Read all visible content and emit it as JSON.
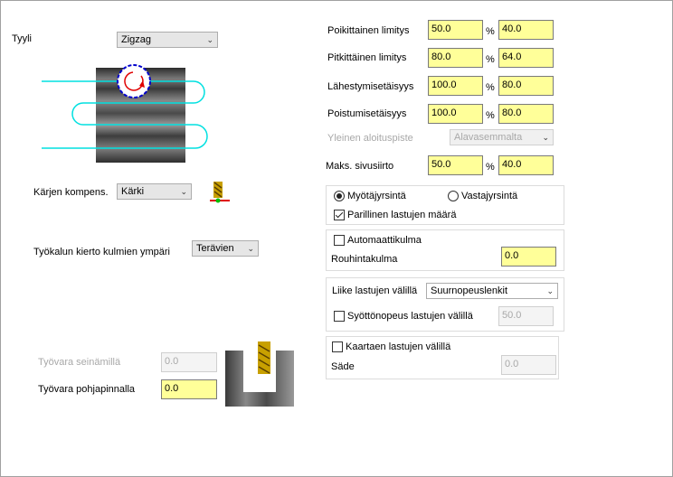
{
  "left": {
    "style_label": "Tyyli",
    "style_value": "Zigzag",
    "edge_comp_label": "Kärjen kompens.",
    "edge_comp_value": "Kärki",
    "corner_label": "Työkalun kierto kulmien ympäri",
    "corner_value": "Terävien",
    "wall_stock_label": "Työvara seinämillä",
    "wall_stock_value": "0.0",
    "floor_stock_label": "Työvara pohjapinnalla",
    "floor_stock_value": "0.0"
  },
  "right": {
    "percent": "%",
    "rows": [
      {
        "label": "Poikittainen limitys",
        "v1": "50.0",
        "v2": "40.0"
      },
      {
        "label": "Pitkittäinen limitys",
        "v1": "80.0",
        "v2": "64.0"
      },
      {
        "label": "Lähestymisetäisyys",
        "v1": "100.0",
        "v2": "80.0"
      },
      {
        "label": "Poistumisetäisyys",
        "v1": "100.0",
        "v2": "80.0"
      }
    ],
    "start_point_label": "Yleinen aloituspiste",
    "start_point_value": "Alavasemmalta",
    "max_side_label": "Maks. sivusiirto",
    "max_side_v1": "50.0",
    "max_side_v2": "40.0",
    "climb_label": "Myötäjyrsintä",
    "conventional_label": "Vastajyrsintä",
    "even_passes_label": "Parillinen lastujen määrä",
    "auto_angle_label": "Automaattikulma",
    "rough_angle_label": "Rouhintakulma",
    "rough_angle_value": "0.0",
    "move_between_label": "Liike lastujen välillä",
    "move_between_value": "Suurnopeuslenkit",
    "feed_between_label": "Syöttönopeus lastujen välillä",
    "feed_between_value": "50.0",
    "arc_between_label": "Kaartaen lastujen välillä",
    "radius_label": "Säde",
    "radius_value": "0.0"
  },
  "colors": {
    "input_bg": "#ffff99",
    "toolpath": "#00e0e0",
    "tool_circle": "#0000cc",
    "arrow": "#e00000"
  },
  "icons": {
    "chevron": "chevron-down-icon",
    "tool": "tool-tip-icon"
  }
}
